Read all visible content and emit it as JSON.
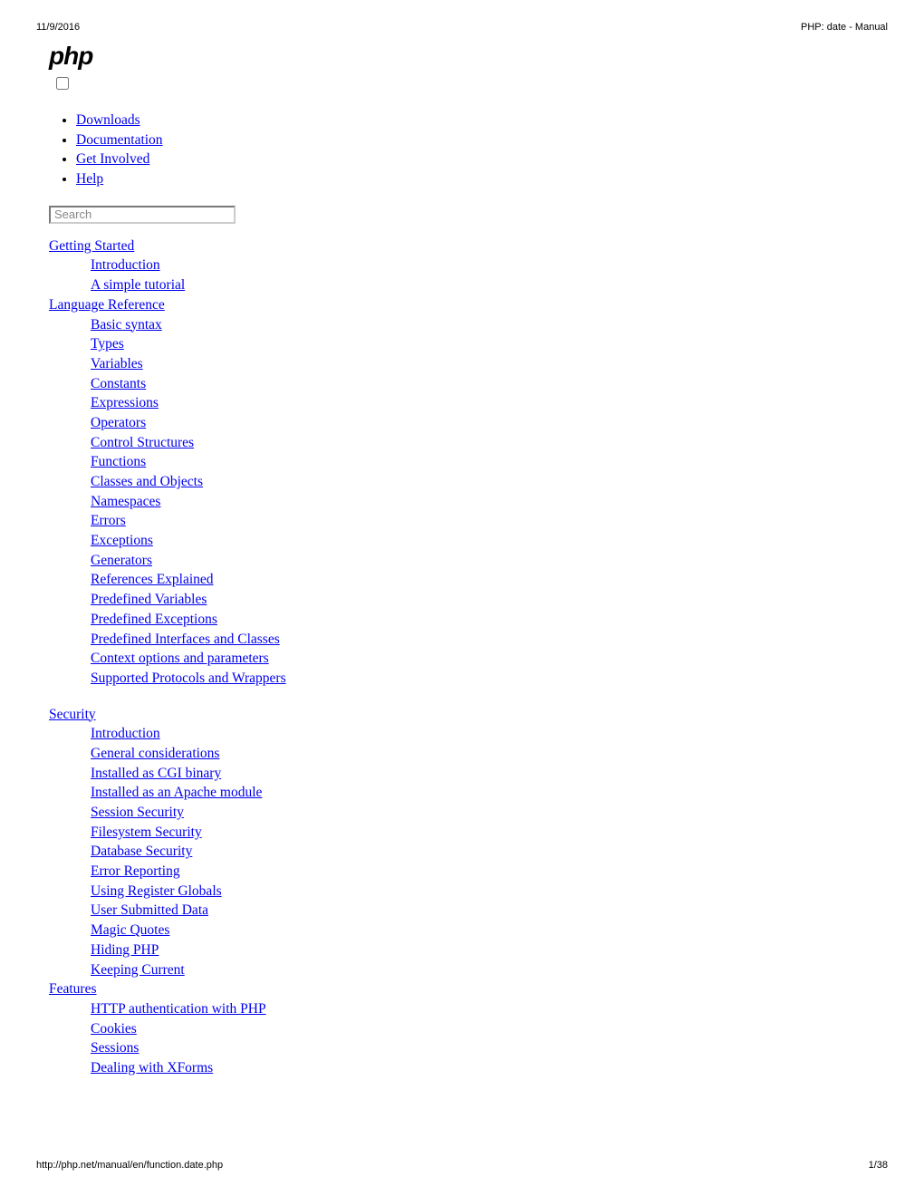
{
  "header": {
    "date": "11/9/2016",
    "title": "PHP: date - Manual"
  },
  "logo": "php",
  "topnav": [
    "Downloads",
    "Documentation",
    "Get Involved",
    "Help"
  ],
  "search": {
    "placeholder": "Search"
  },
  "sections": [
    {
      "heading": "Getting Started",
      "items": [
        "Introduction",
        "A simple tutorial"
      ]
    },
    {
      "heading": "Language Reference",
      "items": [
        "Basic syntax",
        "Types",
        "Variables",
        "Constants",
        "Expressions",
        "Operators",
        "Control Structures",
        "Functions",
        "Classes and Objects",
        "Namespaces",
        "Errors",
        "Exceptions",
        "Generators",
        "References Explained",
        "Predefined Variables",
        "Predefined Exceptions",
        "Predefined Interfaces and Classes",
        "Context options and parameters",
        "Supported Protocols and Wrappers"
      ],
      "gap_after": true
    },
    {
      "heading": "Security",
      "items": [
        "Introduction",
        "General considerations",
        "Installed as CGI binary",
        "Installed as an Apache module",
        "Session Security",
        "Filesystem Security",
        "Database Security",
        "Error Reporting",
        "Using Register Globals",
        "User Submitted Data",
        "Magic Quotes",
        "Hiding PHP",
        "Keeping Current"
      ]
    },
    {
      "heading": "Features",
      "items": [
        "HTTP authentication with PHP",
        "Cookies",
        "Sessions",
        "Dealing with XForms"
      ]
    }
  ],
  "footer": {
    "url": "http://php.net/manual/en/function.date.php",
    "pagenum": "1/38"
  }
}
